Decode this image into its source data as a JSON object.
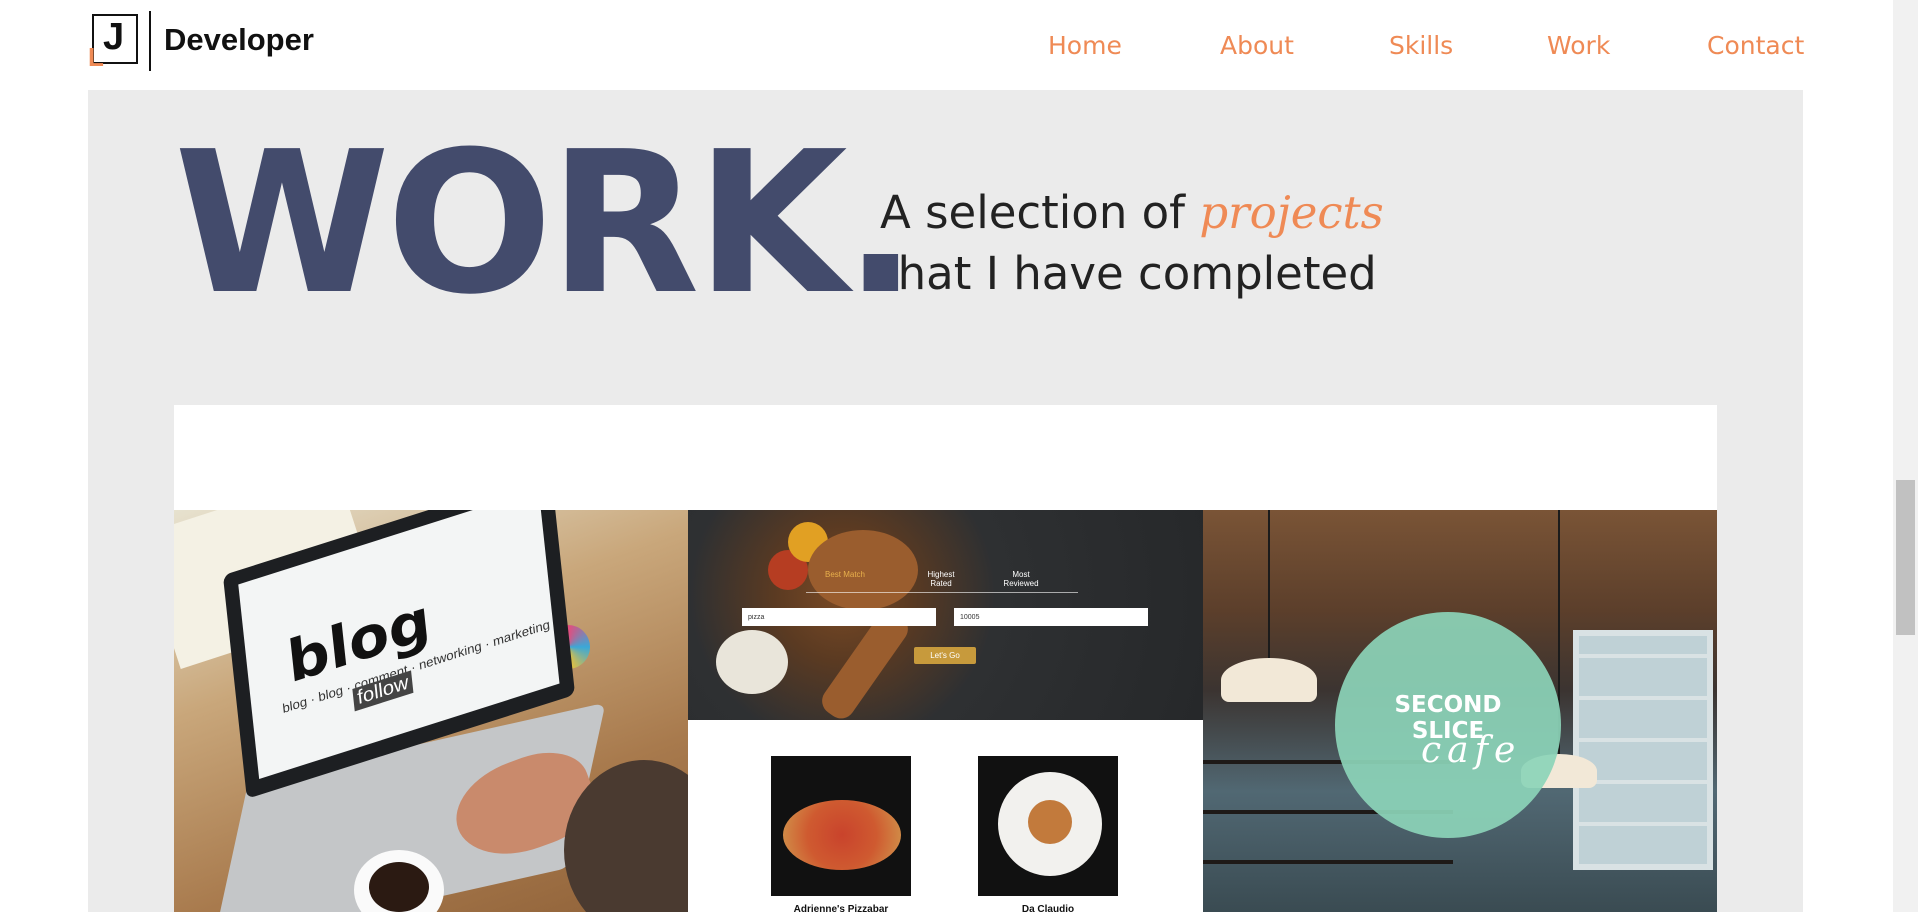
{
  "header": {
    "logo": {
      "mark_letter": "J",
      "mark_accent_letter": "L",
      "text": "Developer"
    },
    "nav": [
      {
        "label": "Home"
      },
      {
        "label": "About"
      },
      {
        "label": "Skills"
      },
      {
        "label": "Work"
      },
      {
        "label": "Contact"
      }
    ]
  },
  "work": {
    "big_title": "WORK.",
    "tagline_prefix": "A selection of ",
    "tagline_accent": "projects",
    "tagline_line2": "that I have completed"
  },
  "projects": [
    {
      "name": "blog",
      "screen_text": "blog",
      "screen_subtext": "blog · blog · comment · networking · marketing",
      "screen_follow": "follow"
    },
    {
      "name": "restaurant-search",
      "tabs": [
        {
          "label": "Best Match",
          "active": true
        },
        {
          "label": "Highest Rated",
          "active": false
        },
        {
          "label": "Most Reviewed",
          "active": false
        }
      ],
      "search_term": "pizza",
      "zip_code": "10005",
      "submit_label": "Let's Go",
      "results": [
        {
          "name": "Adrienne's Pizzabar"
        },
        {
          "name": "Da Claudio"
        }
      ]
    },
    {
      "name": "second-slice-cafe",
      "logo_line1": "SECOND",
      "logo_line2": "SLICE",
      "logo_script": "cafe"
    }
  ],
  "colors": {
    "accent": "#ef8a55",
    "title": "#434b6c",
    "section_bg": "#ebebeb",
    "cafe_circle": "#8cd4b8"
  }
}
